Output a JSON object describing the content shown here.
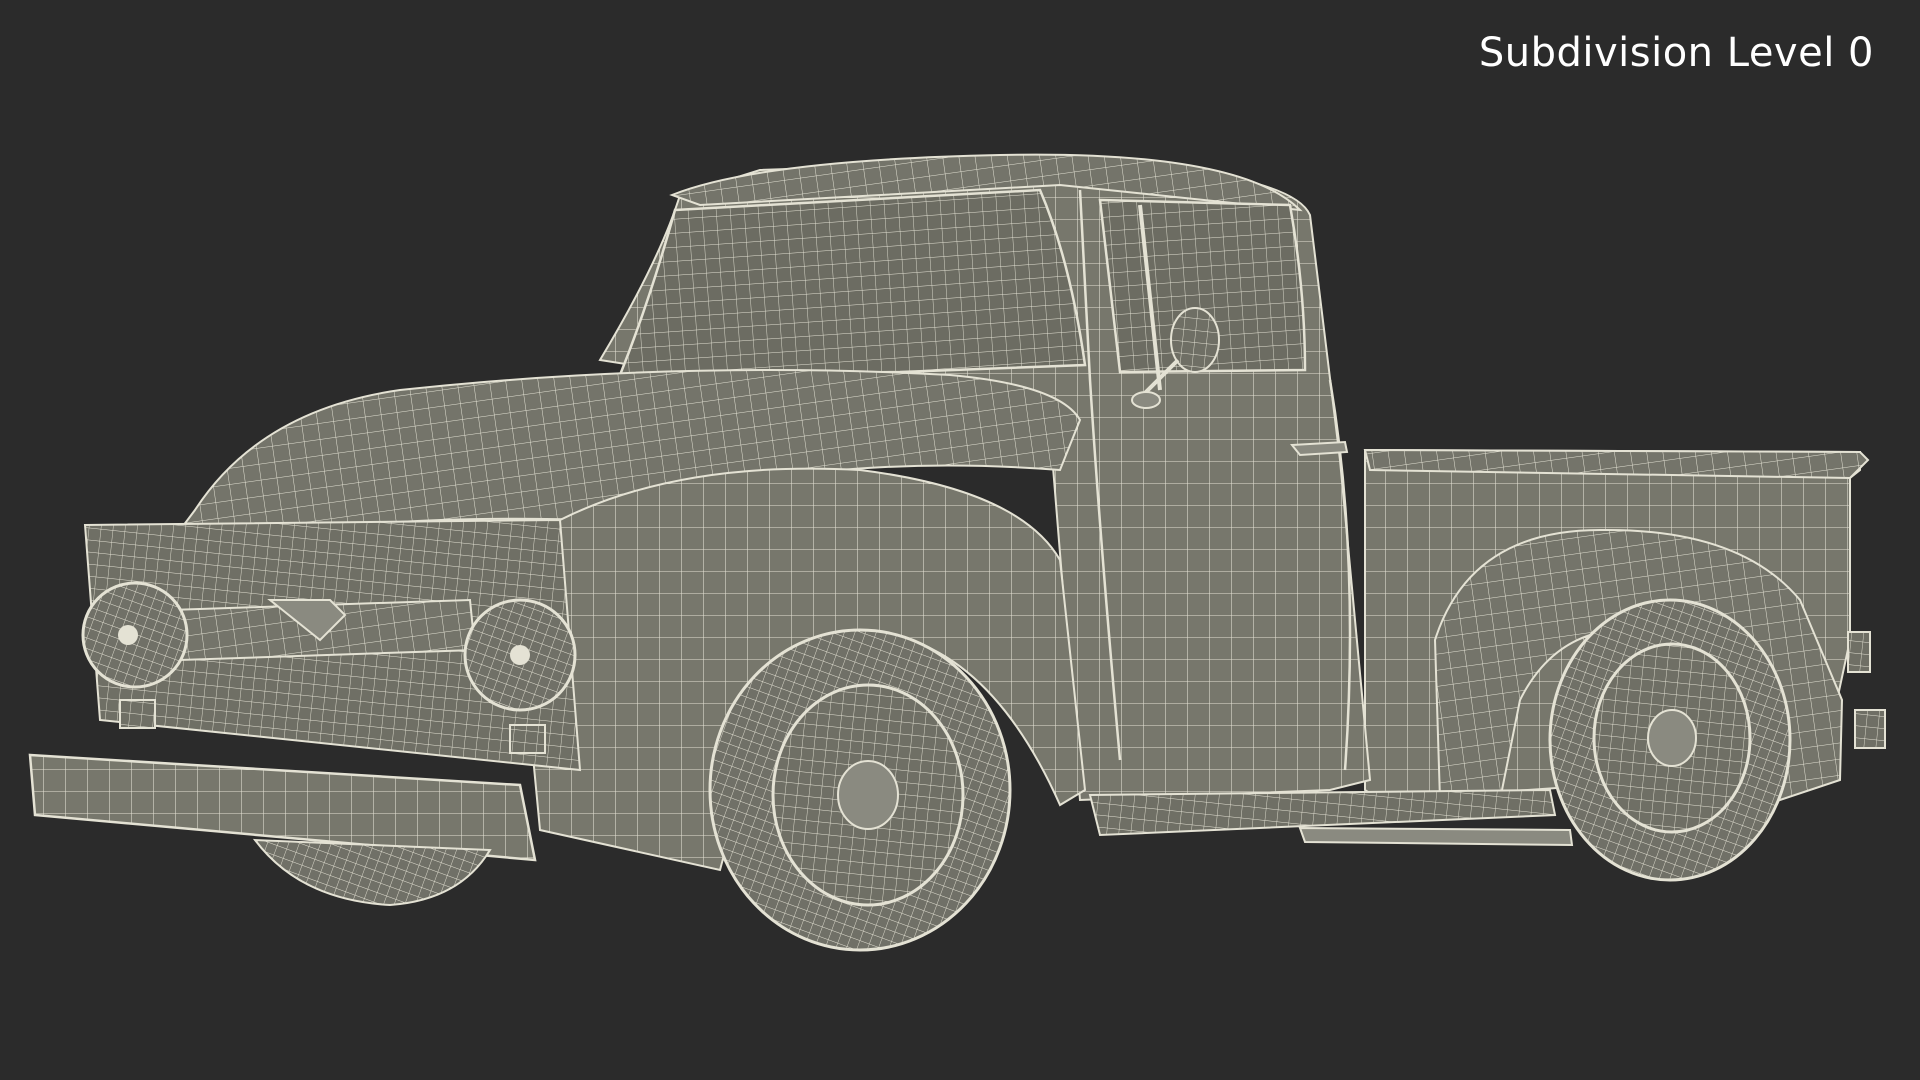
{
  "viewport": {
    "subdivision_label": "Subdivision Level 0",
    "background_color": "#2b2b2b",
    "mesh_fill_color": "#77776c",
    "wire_color": "#e4e2d4"
  }
}
